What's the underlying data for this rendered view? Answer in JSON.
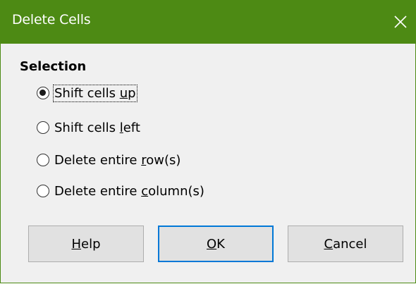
{
  "window": {
    "title": "Delete Cells"
  },
  "selection": {
    "heading": "Selection",
    "options": [
      {
        "pre": "Shift cells ",
        "key": "u",
        "post": "p",
        "checked": true
      },
      {
        "pre": "Shift cells ",
        "key": "l",
        "post": "eft",
        "checked": false
      },
      {
        "pre": "Delete entire ",
        "key": "r",
        "post": "ow(s)",
        "checked": false
      },
      {
        "pre": "Delete entire ",
        "key": "c",
        "post": "olumn(s)",
        "checked": false
      }
    ]
  },
  "buttons": {
    "help": {
      "key": "H",
      "rest": "elp"
    },
    "ok": {
      "key": "O",
      "rest": "K"
    },
    "cancel": {
      "key": "C",
      "rest": "ancel"
    }
  },
  "colors": {
    "titlebar": "#4d8a14",
    "default_button_border": "#0078d7"
  },
  "icons": {
    "close": "close-icon"
  }
}
